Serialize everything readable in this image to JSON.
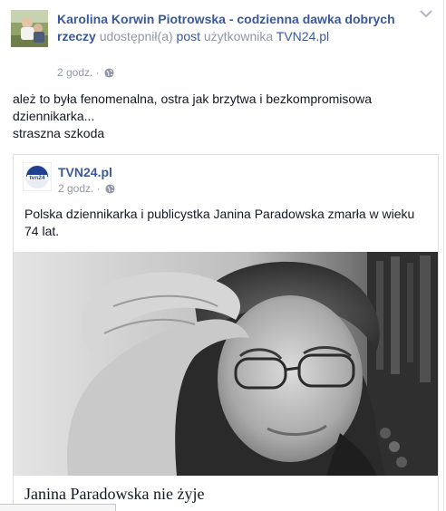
{
  "post": {
    "author": "Karolina Korwin Piotrowska - codzienna dawka dobrych rzeczy",
    "action_text": "udostępnił(a)",
    "post_link": "post",
    "of_user_text": "użytkownika",
    "source_name": "TVN24.pl",
    "timestamp": "2 godz.",
    "privacy_icon": "globe-icon",
    "menu_icon": "chevron-down-icon",
    "text_lines": [
      "ależ to była fenomenalna, ostra jak brzytwa i bezkompromisowa",
      "dziennikarka...",
      "straszna szkoda"
    ]
  },
  "shared": {
    "page_name": "TVN24.pl",
    "logo_text": "tvn24",
    "timestamp": "2 godz.",
    "text": "Polska dziennikarka i publicystka Janina Paradowska zmarła w wieku 74 lat.",
    "article_title": "Janina Paradowska nie żyje"
  },
  "colors": {
    "link": "#3b5998",
    "muted": "#9197a3",
    "text": "#141823",
    "border": "#dddfe2"
  }
}
